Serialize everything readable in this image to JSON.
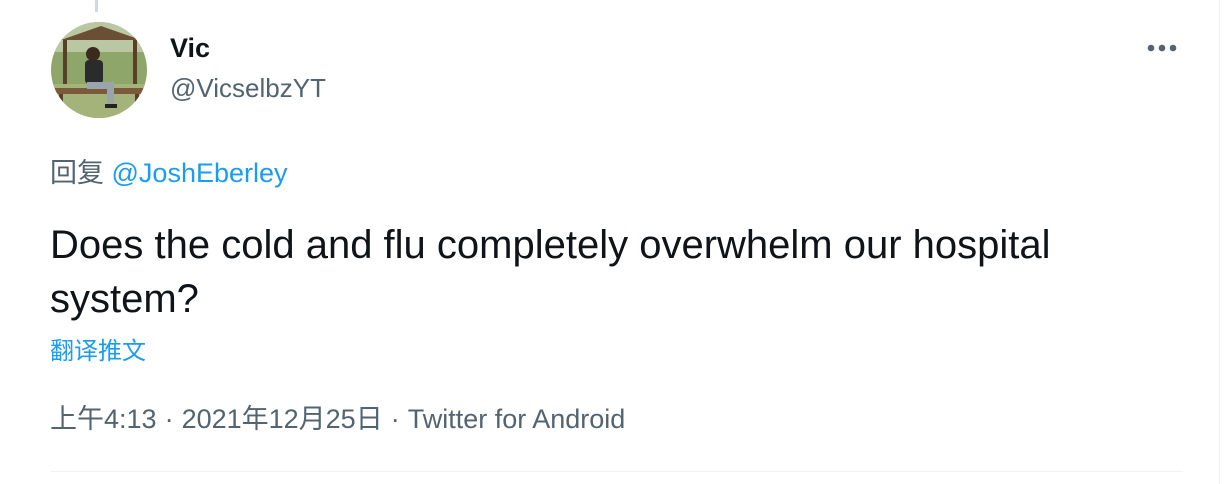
{
  "author": {
    "display_name": "Vic",
    "handle": "@VicselbzYT"
  },
  "reply": {
    "prefix": "回复",
    "mention": "@JoshEberley"
  },
  "tweet": {
    "text": "Does the cold and flu completely overwhelm our hospital system?",
    "translate_label": "翻译推文"
  },
  "meta": {
    "time": "上午4:13",
    "separator": "·",
    "date": "2021年12月25日",
    "source": "Twitter for Android"
  },
  "colors": {
    "link": "#1d9bf0",
    "secondary_text": "#536471",
    "primary_text": "#0f1419",
    "divider": "#eff3f4"
  },
  "icons": {
    "more": "more-horizontal-icon"
  }
}
